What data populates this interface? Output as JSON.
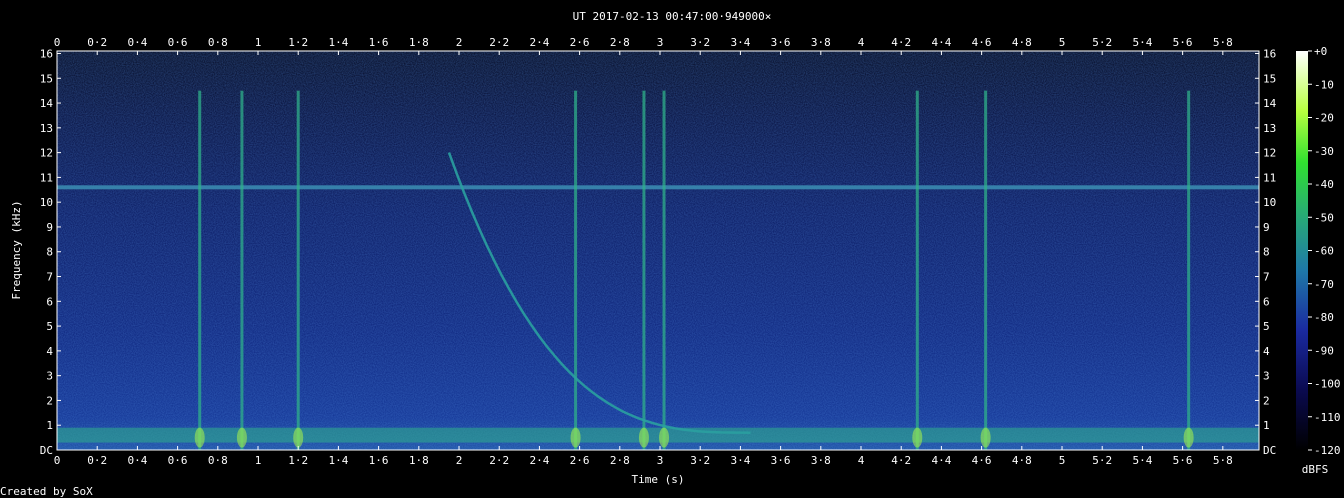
{
  "chart_data": {
    "type": "heatmap",
    "title": "UT 2017-02-13 00:47:00·949000×",
    "xlabel": "Time (s)",
    "ylabel": "Frequency (kHz)",
    "xlim": [
      0,
      5.98
    ],
    "ylim": [
      0,
      16.1
    ],
    "x_ticks": [
      "0",
      "0·2",
      "0·4",
      "0·6",
      "0·8",
      "1",
      "1·2",
      "1·4",
      "1·6",
      "1·8",
      "2",
      "2·2",
      "2·4",
      "2·6",
      "2·8",
      "3",
      "3·2",
      "3·4",
      "3·6",
      "3·8",
      "4",
      "4·2",
      "4·4",
      "4·6",
      "4·8",
      "5",
      "5·2",
      "5·4",
      "5·6",
      "5·8"
    ],
    "y_ticks": [
      "DC",
      "1",
      "2",
      "3",
      "4",
      "5",
      "6",
      "7",
      "8",
      "9",
      "10",
      "11",
      "12",
      "13",
      "14",
      "15",
      "16"
    ],
    "colorbar": {
      "label": "dBFS",
      "range": [
        -120,
        0
      ],
      "ticks": [
        "+0",
        "-10",
        "-20",
        "-30",
        "-40",
        "-50",
        "-60",
        "-70",
        "-80",
        "-90",
        "-100",
        "-110",
        "-120"
      ]
    },
    "features": {
      "tone_line_khz": 10.6,
      "whistler_trace": {
        "t_start_s": 1.95,
        "f_start_khz": 12.0,
        "t_end_s": 3.45,
        "f_end_khz": 0.7
      },
      "impulses_s": [
        0.71,
        0.92,
        1.2,
        2.58,
        2.92,
        3.02,
        4.28,
        4.62,
        5.63
      ]
    },
    "colors": {
      "background": "#000000",
      "noise": "#0a1a6a",
      "signal": "#2fb08a",
      "peak": "#b8ff40"
    }
  },
  "footer": {
    "credit": "Created by SoX"
  }
}
